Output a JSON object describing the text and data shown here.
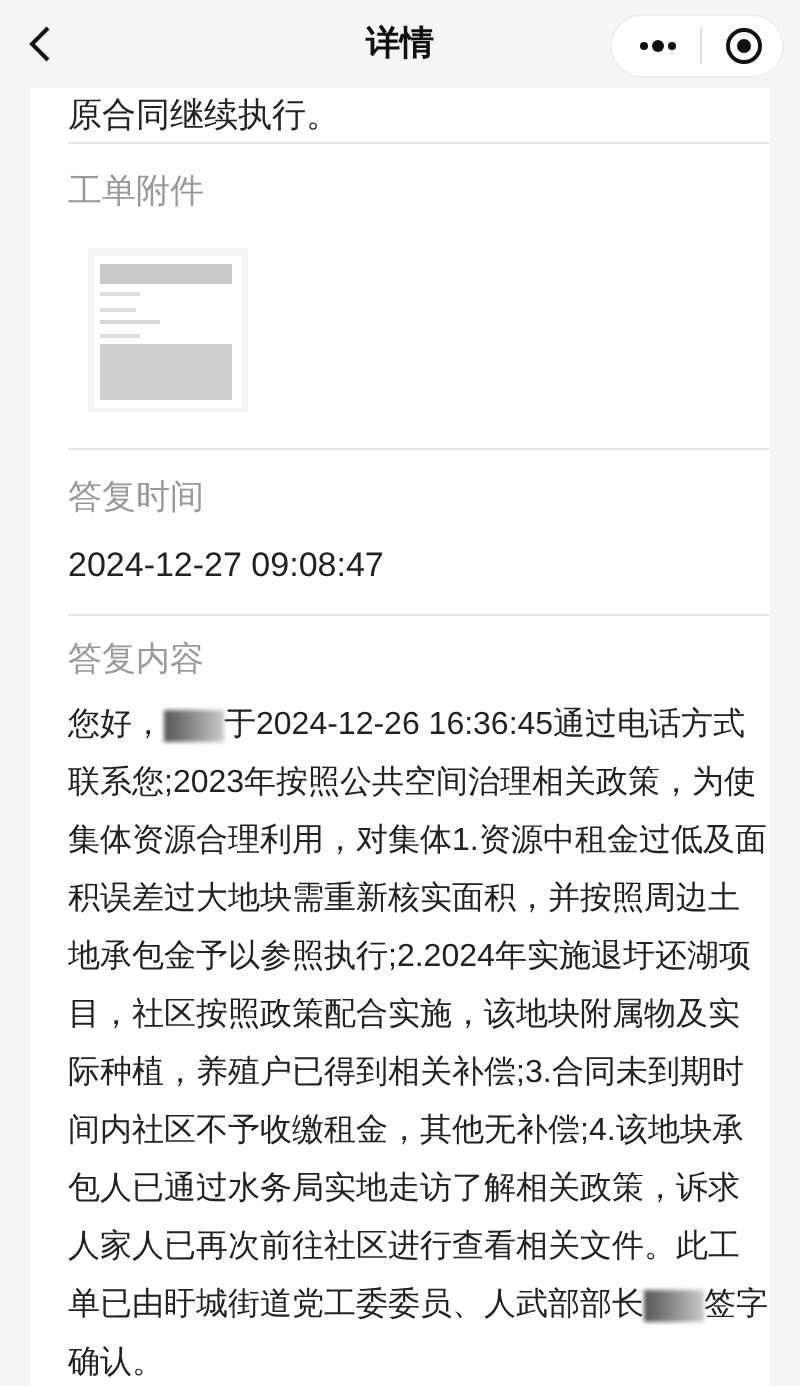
{
  "header": {
    "title": "详情"
  },
  "top_text": "原合同继续执行。",
  "attachments": {
    "label": "工单附件"
  },
  "reply_time": {
    "label": "答复时间",
    "value": "2024-12-27 09:08:47"
  },
  "reply_content": {
    "label": "答复内容",
    "parts": [
      {
        "kind": "text",
        "text": "您好，"
      },
      {
        "kind": "redacted"
      },
      {
        "kind": "text",
        "text": "于2024-12-26 16:36:45通过电话方式联系您;2023年按照公共空间治理相关政策，为使集体资源合理利用，对集体1.资源中租金过低及面积误差过大地块需重新核实面积，并按照周边土地承包金予以参照执行;2.2024年实施退圩还湖项目，社区按照政策配合实施，该地块附属物及实际种植，养殖户已得到相关补偿;3.合同未到期时间内社区不予收缴租金，其他无补偿;4.该地块承包人已通过水务局实地走访了解相关政策，诉求人家人已再次前往社区进行查看相关文件。此工单已由盱城街道党工委委员、人武部部长"
      },
      {
        "kind": "redacted"
      },
      {
        "kind": "text",
        "text": "签字确认。"
      }
    ]
  }
}
